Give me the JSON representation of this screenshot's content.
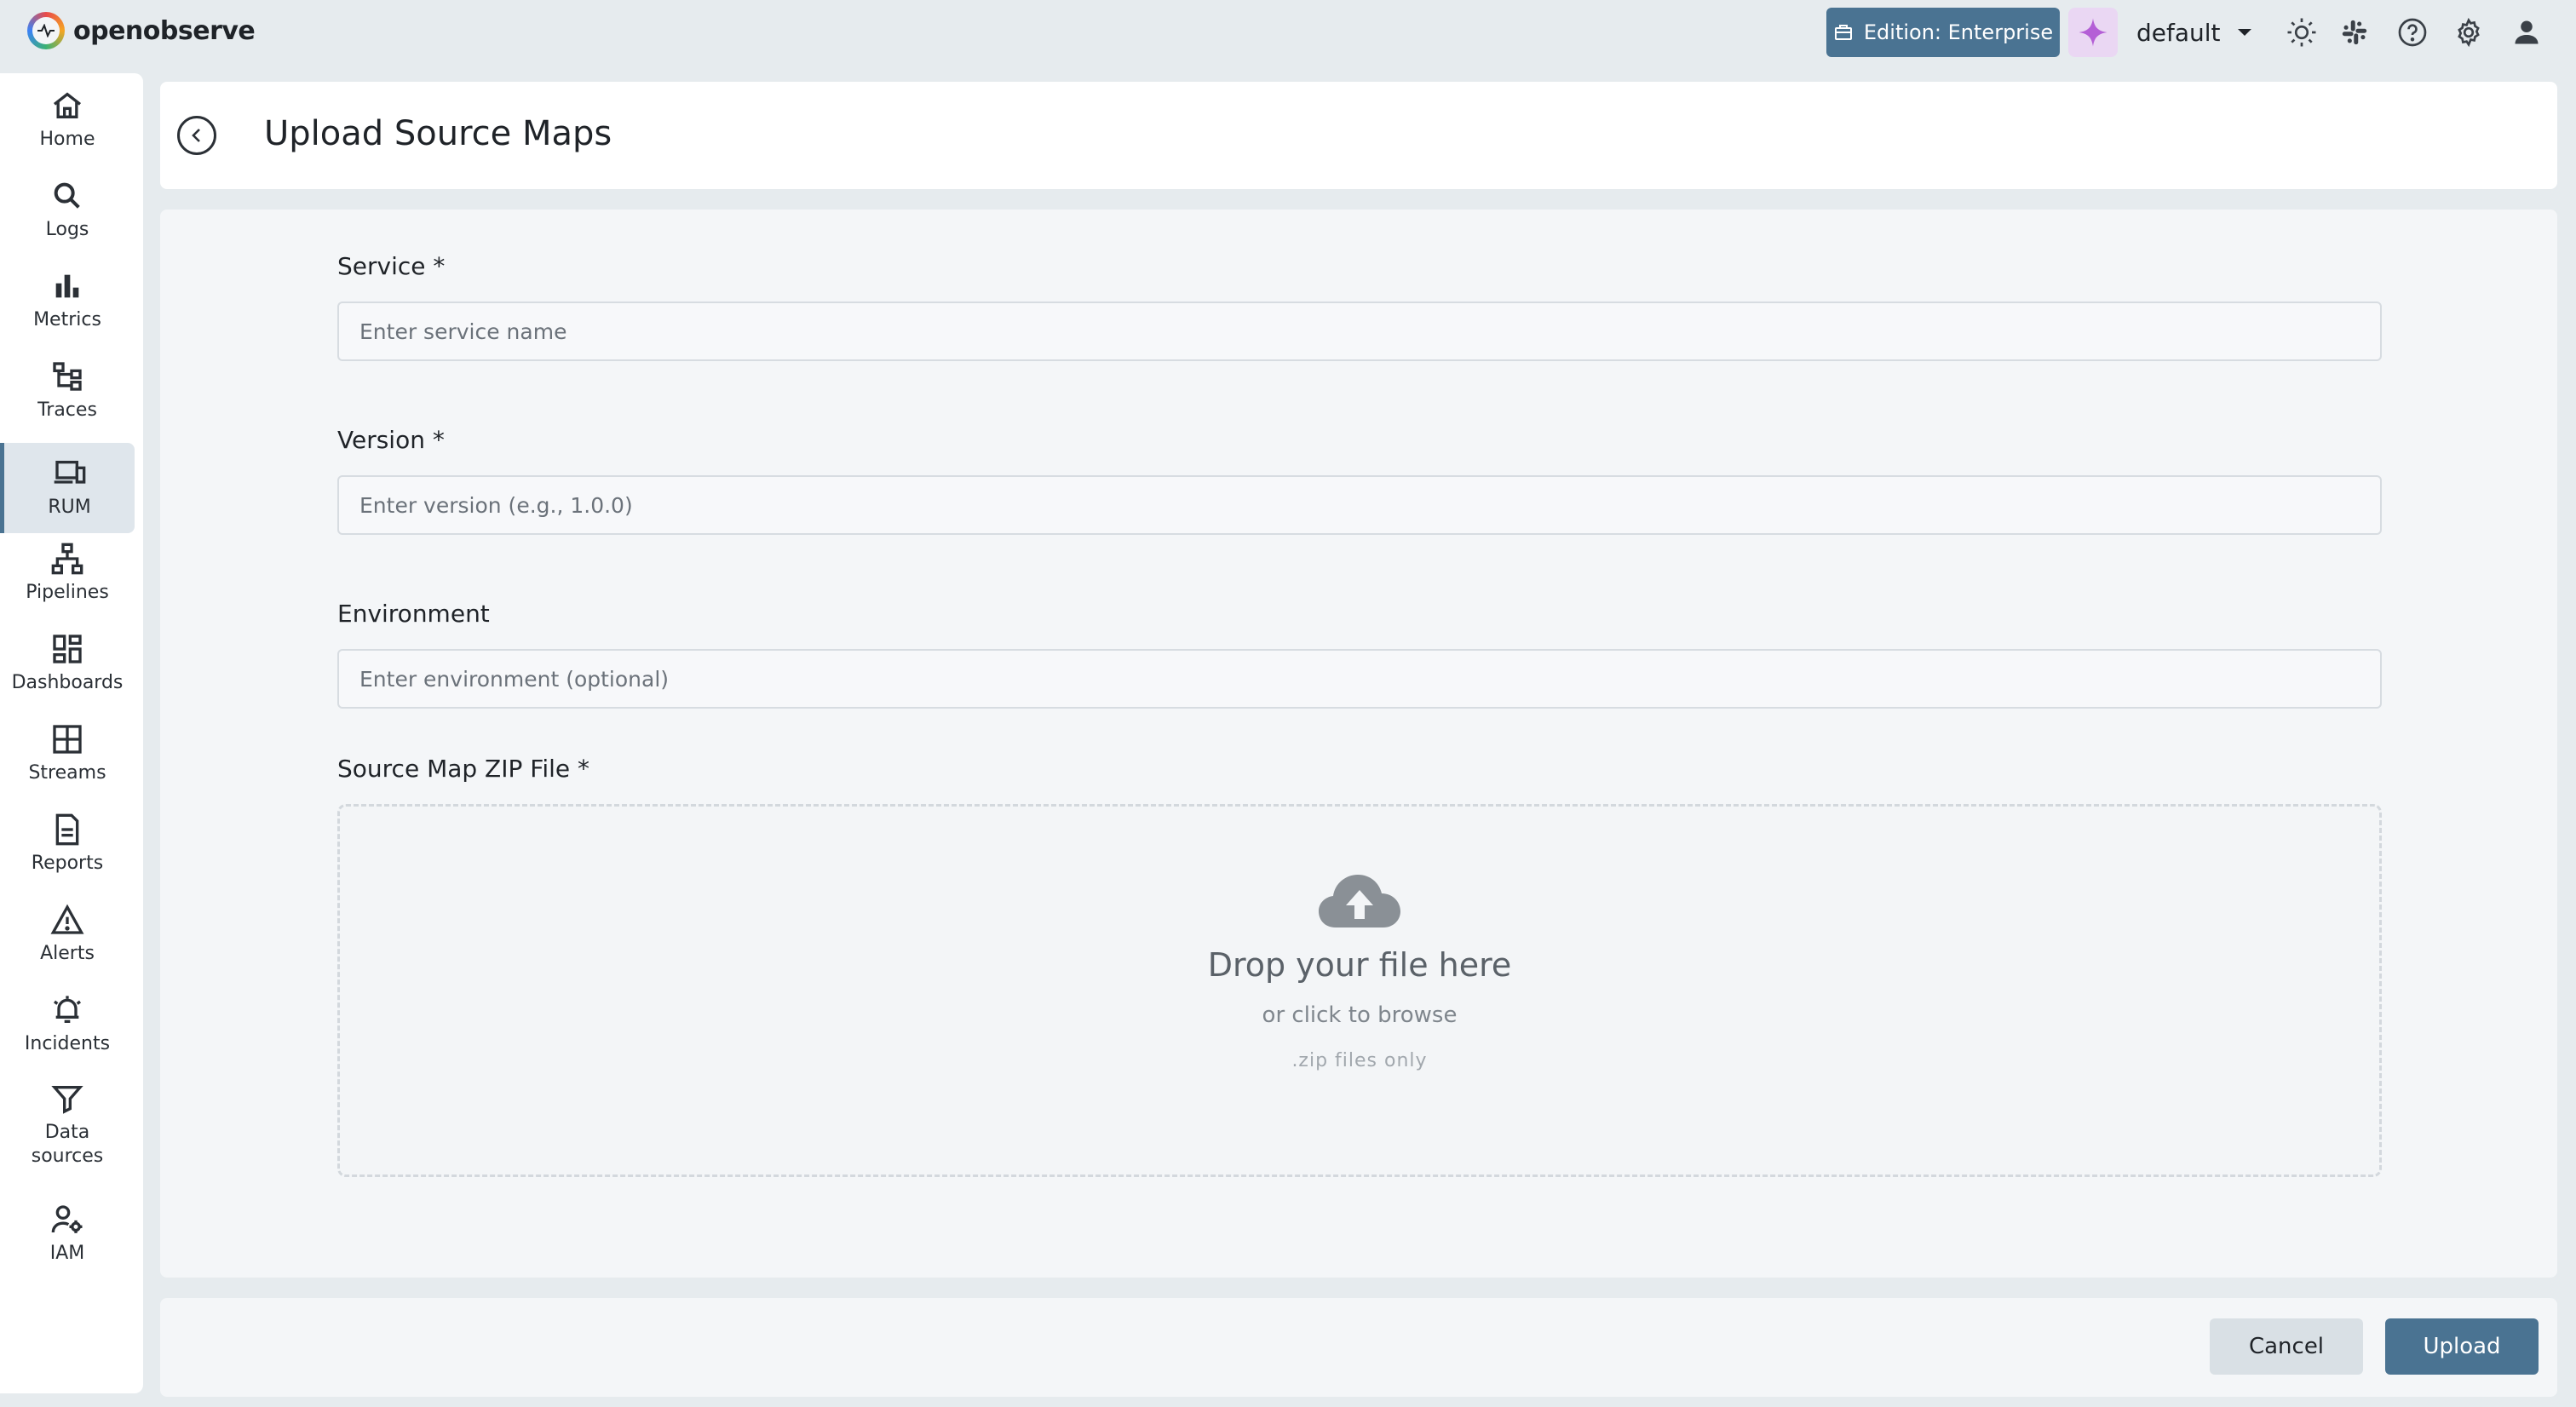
{
  "app": {
    "logo_text": "openobserve",
    "edition_label": "Edition: Enterprise",
    "org_name": "default"
  },
  "icons": {
    "top": [
      "theme-toggle-icon",
      "slack-icon",
      "help-icon",
      "settings-icon",
      "user-icon"
    ]
  },
  "sidebar": {
    "items": [
      {
        "label": "Home",
        "icon": "home-icon"
      },
      {
        "label": "Logs",
        "icon": "search-icon"
      },
      {
        "label": "Metrics",
        "icon": "bar-chart-icon"
      },
      {
        "label": "Traces",
        "icon": "traces-icon"
      },
      {
        "label": "RUM",
        "icon": "devices-icon",
        "active": true
      },
      {
        "label": "Pipelines",
        "icon": "pipelines-icon"
      },
      {
        "label": "Dashboards",
        "icon": "dashboards-icon"
      },
      {
        "label": "Streams",
        "icon": "streams-icon"
      },
      {
        "label": "Reports",
        "icon": "reports-icon"
      },
      {
        "label": "Alerts",
        "icon": "alert-icon"
      },
      {
        "label": "Incidents",
        "icon": "incidents-icon"
      },
      {
        "label": "Data sources",
        "icon": "filter-icon"
      },
      {
        "label": "IAM",
        "icon": "iam-icon"
      }
    ]
  },
  "header": {
    "title": "Upload Source Maps"
  },
  "form": {
    "service": {
      "label": "Service *",
      "placeholder": "Enter service name",
      "value": ""
    },
    "version": {
      "label": "Version *",
      "placeholder": "Enter version (e.g., 1.0.0)",
      "value": ""
    },
    "environment": {
      "label": "Environment",
      "placeholder": "Enter environment (optional)",
      "value": ""
    },
    "zip": {
      "label": "Source Map ZIP File *",
      "drop_title": "Drop your file here",
      "drop_subtitle": "or click to browse",
      "drop_hint": ".zip files only"
    }
  },
  "footer": {
    "cancel_label": "Cancel",
    "upload_label": "Upload"
  },
  "colors": {
    "accent": "#4a7392",
    "background": "#e6ebee",
    "ai_button": "#ead7f3"
  }
}
